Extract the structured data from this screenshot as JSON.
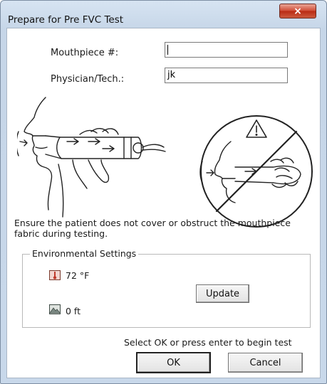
{
  "window": {
    "title": "Prepare for Pre FVC Test",
    "close_glyph": "×",
    "close_icon": "close-icon"
  },
  "form": {
    "mouthpiece_label": "Mouthpiece #:",
    "mouthpiece_value": "",
    "tech_label": "Physician/Tech.:",
    "tech_value": "jk"
  },
  "illustration": {
    "left_icon": "patient-blowing-into-mouthpiece-illustration",
    "right_icon": "prohibited-obstructed-mouthpiece-illustration",
    "warning_icon": "warning-triangle-icon",
    "warning_glyph": "!"
  },
  "instruction": "Ensure the patient does not cover or obstruct the mouthpiece fabric during testing.",
  "environment": {
    "legend": "Environmental Settings",
    "temperature": "72 °F",
    "temperature_icon": "thermometer-icon",
    "altitude": "0 ft",
    "altitude_icon": "mountain-icon",
    "update_label": "Update"
  },
  "footer": {
    "hint": "Select OK or press enter to begin test",
    "ok_label": "OK",
    "cancel_label": "Cancel"
  }
}
